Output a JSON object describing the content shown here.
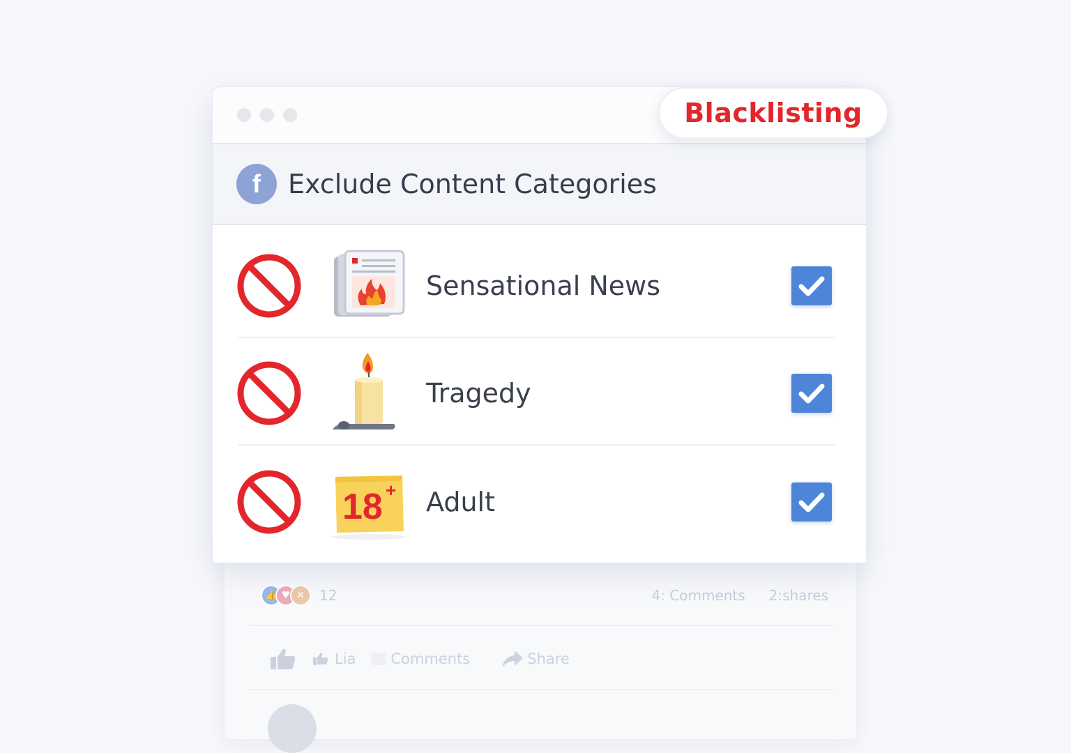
{
  "badge": {
    "label": "Blacklisting",
    "color": "#e3262b"
  },
  "window": {
    "dots": 3
  },
  "panel": {
    "icon": "facebook-icon",
    "icon_glyph": "f",
    "title": "Exclude Content Categories"
  },
  "categories": [
    {
      "label": "Sensational News",
      "icon": "burning-newspaper-icon",
      "blocked": true,
      "checked": true
    },
    {
      "label": "Tragedy",
      "icon": "candle-icon",
      "blocked": true,
      "checked": true
    },
    {
      "label": "Adult",
      "icon": "adult-18-plus-icon",
      "blocked": true,
      "checked": true
    }
  ],
  "background_post": {
    "reaction_count": "12",
    "comments_count": "4: Comments",
    "shares_count": "2:shares",
    "actions": {
      "like": "Lia",
      "comment": "Comments",
      "share": "Share"
    }
  },
  "colors": {
    "accent_blue": "#4d86d9",
    "ban_red": "#e3262b",
    "facebook_blue": "#8da3d6"
  }
}
